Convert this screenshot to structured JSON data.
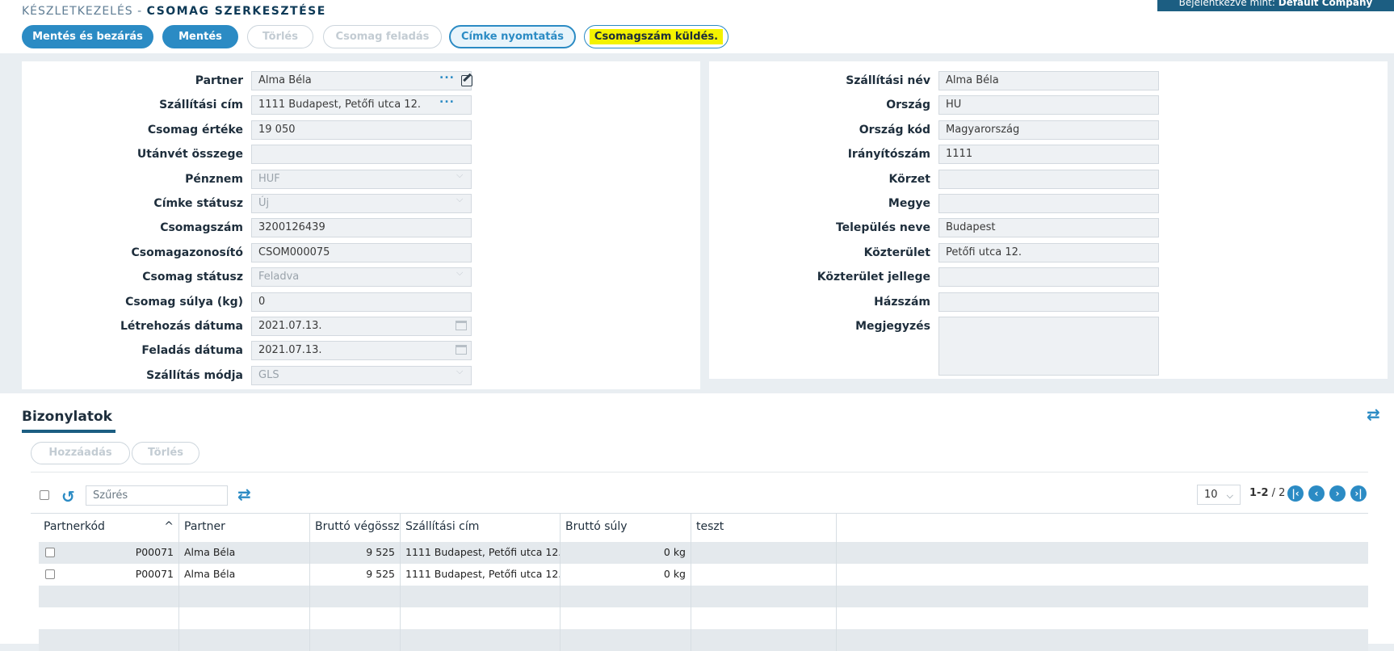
{
  "header": {
    "breadcrumb_root": "KÉSZLETKEZELÉS -",
    "page_title": "CSOMAG SZERKESZTÉSE",
    "user_prefix": "Bejelentkezve mint:",
    "user_name": "Default Company"
  },
  "toolbar": {
    "save_close": "Mentés és bezárás",
    "save": "Mentés",
    "delete": "Törlés",
    "send_package": "Csomag feladás",
    "print_label": "Címke nyomtatás",
    "send_number": "Csomagszám küldés."
  },
  "left_form": [
    {
      "label": "Partner",
      "value": "Alma Béla",
      "kind": "lookup"
    },
    {
      "label": "Szállítási cím",
      "value": "1111 Budapest, Petőfi utca 12.",
      "kind": "lookup"
    },
    {
      "label": "Csomag értéke",
      "value": "19 050",
      "kind": "text"
    },
    {
      "label": "Utánvét összege",
      "value": "",
      "kind": "text"
    },
    {
      "label": "Pénznem",
      "value": "HUF",
      "kind": "select"
    },
    {
      "label": "Címke státusz",
      "value": "Új",
      "kind": "select"
    },
    {
      "label": "Csomagszám",
      "value": "3200126439",
      "kind": "text"
    },
    {
      "label": "Csomagazonosító",
      "value": "CSOM000075",
      "kind": "text"
    },
    {
      "label": "Csomag státusz",
      "value": "Feladva",
      "kind": "select"
    },
    {
      "label": "Csomag súlya (kg)",
      "value": "0",
      "kind": "text"
    },
    {
      "label": "Létrehozás dátuma",
      "value": "2021.07.13.",
      "kind": "date"
    },
    {
      "label": "Feladás dátuma",
      "value": "2021.07.13.",
      "kind": "date"
    },
    {
      "label": "Szállítás módja",
      "value": "GLS",
      "kind": "select"
    }
  ],
  "right_form": [
    {
      "label": "Szállítási név",
      "value": "Alma Béla"
    },
    {
      "label": "Ország",
      "value": "HU"
    },
    {
      "label": "Ország kód",
      "value": "Magyarország"
    },
    {
      "label": "Irányítószám",
      "value": "1111"
    },
    {
      "label": "Körzet",
      "value": ""
    },
    {
      "label": "Megye",
      "value": ""
    },
    {
      "label": "Település neve",
      "value": "Budapest"
    },
    {
      "label": "Közterület",
      "value": "Petőfi utca 12."
    },
    {
      "label": "Közterület jellege",
      "value": ""
    },
    {
      "label": "Házszám",
      "value": ""
    },
    {
      "label": "Megjegyzés",
      "value": ""
    }
  ],
  "documents": {
    "tab_label": "Bizonylatok",
    "add_label": "Hozzáadás",
    "delete_label": "Törlés",
    "filter_placeholder": "Szűrés",
    "page_size": "10",
    "range": "1-2",
    "total": "/ 2",
    "columns": [
      "Partnerkód",
      "Partner",
      "Bruttó végösszeg",
      "Szállítási cím",
      "Bruttó súly",
      "teszt"
    ],
    "rows": [
      [
        "P00071",
        "Alma Béla",
        "9 525",
        "1111 Budapest, Petőfi utca 12.",
        "0 kg",
        ""
      ],
      [
        "P00071",
        "Alma Béla",
        "9 525",
        "1111 Budapest, Petőfi utca 12.",
        "0 kg",
        ""
      ]
    ]
  },
  "icons": {
    "edit": "edit-icon",
    "more": "ellipsis-icon",
    "calendar": "calendar-icon",
    "swap": "swap-arrows-icon",
    "refresh": "refresh-icon"
  }
}
